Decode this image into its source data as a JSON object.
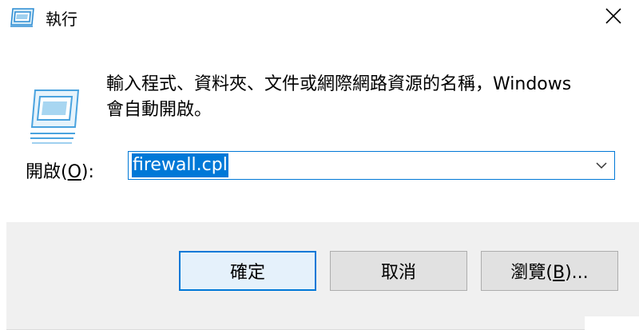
{
  "window": {
    "title": "執行"
  },
  "content": {
    "description_line1": "輸入程式、資料夾、文件或網際網路資源的名稱，Windows",
    "description_line2": "會自動開啟。",
    "open_label_prefix": "開啟(",
    "open_label_mnemonic": "O",
    "open_label_suffix": "):",
    "input_value": "firewall.cpl"
  },
  "buttons": {
    "ok_label": "確定",
    "cancel_label": "取消",
    "browse_prefix": "瀏覽(",
    "browse_mnemonic": "B",
    "browse_suffix": ")..."
  },
  "colors": {
    "accent": "#0078d7",
    "footer_bg": "#f0f0f0"
  },
  "icons": [
    "run-app-icon",
    "close-icon",
    "run-program-icon",
    "chevron-down-icon"
  ]
}
